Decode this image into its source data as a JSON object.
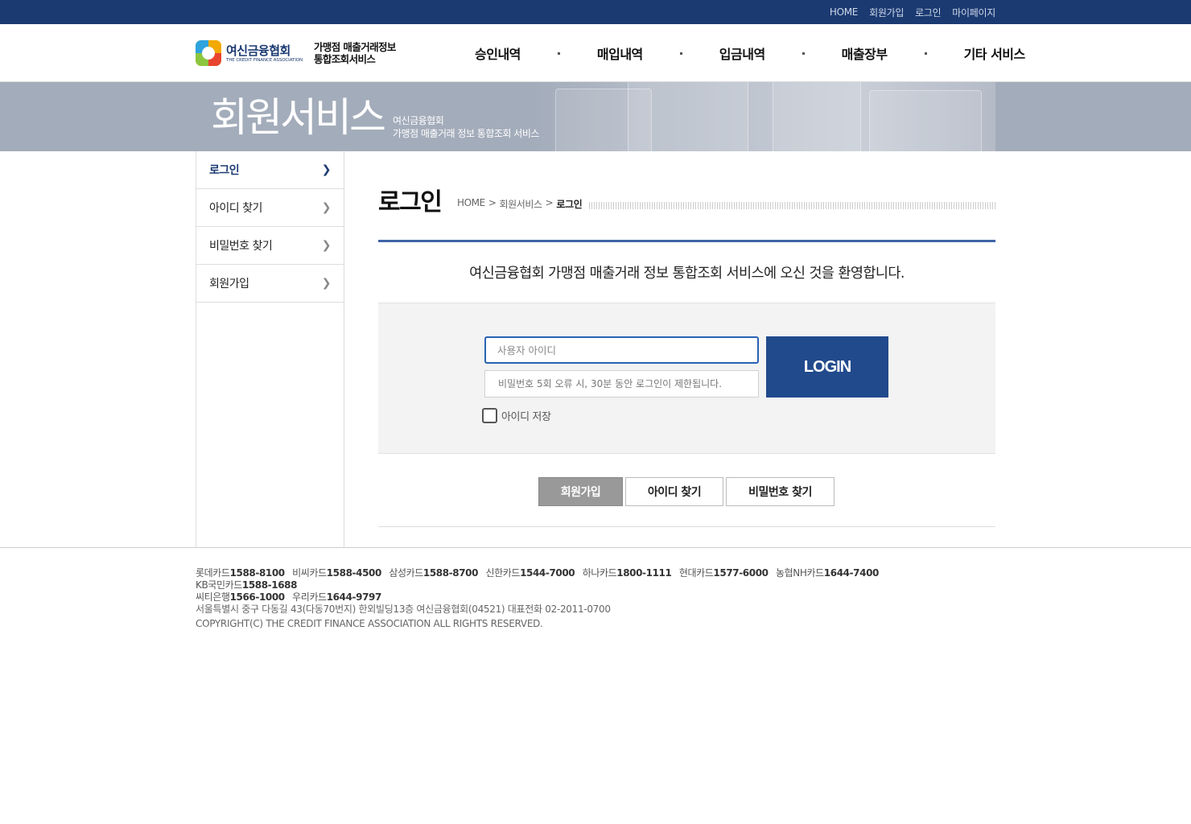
{
  "topbar": {
    "links": [
      "HOME",
      "회원가입",
      "로그인",
      "마이페이지"
    ]
  },
  "header": {
    "logo_ko": "여신금융협회",
    "logo_en": "THE CREDIT FINANCE ASSOCIATION",
    "logo_sub_line1": "가맹점 매출거래정보",
    "logo_sub_line2": "통합조회서비스",
    "gnb": [
      "승인내역",
      "매입내역",
      "입금내역",
      "매출장부",
      "기타 서비스"
    ]
  },
  "visual": {
    "title": "회원서비스",
    "desc_line1": "여신금융협회",
    "desc_line2": "가맹점 매출거래 정보 통합조회 서비스"
  },
  "lnb": {
    "items": [
      {
        "label": "로그인",
        "active": true
      },
      {
        "label": "아이디 찾기",
        "active": false
      },
      {
        "label": "비밀번호 찾기",
        "active": false
      },
      {
        "label": "회원가입",
        "active": false
      }
    ]
  },
  "content": {
    "page_title": "로그인",
    "breadcrumb": [
      "HOME",
      "회원서비스",
      "로그인"
    ],
    "welcome": "여신금융협회 가맹점 매출거래 정보 통합조회 서비스에 오신 것을 환영합니다.",
    "login": {
      "id_placeholder": "사용자 아이디",
      "pw_placeholder": "비밀번호 5회 오류 시, 30분 동안 로그인이 제한됩니다.",
      "login_label": "LOGIN",
      "save_id_label": "아이디 저장"
    },
    "buttons": {
      "join": "회원가입",
      "find_id": "아이디 찾기",
      "find_pw": "비밀번호 찾기"
    }
  },
  "footer": {
    "phones": [
      {
        "name": "롯데카드",
        "num": "1588-8100"
      },
      {
        "name": "비씨카드",
        "num": "1588-4500"
      },
      {
        "name": "삼성카드",
        "num": "1588-8700"
      },
      {
        "name": "신한카드",
        "num": "1544-7000"
      },
      {
        "name": "하나카드",
        "num": "1800-1111"
      },
      {
        "name": "현대카드",
        "num": "1577-6000"
      },
      {
        "name": "농협NH카드",
        "num": "1644-7400"
      },
      {
        "name": "KB국민카드",
        "num": "1588-1688"
      },
      {
        "name": "씨티은행",
        "num": "1566-1000"
      },
      {
        "name": "우리카드",
        "num": "1644-9797"
      }
    ],
    "address": "서울특별시 중구 다동길 43(다동70번지) 한외빌딩13층 여신금융협회(04521) 대표전화 02-2011-0700",
    "copyright": "COPYRIGHT(C) THE CREDIT FINANCE ASSOCIATION ALL RIGHTS RESERVED."
  }
}
